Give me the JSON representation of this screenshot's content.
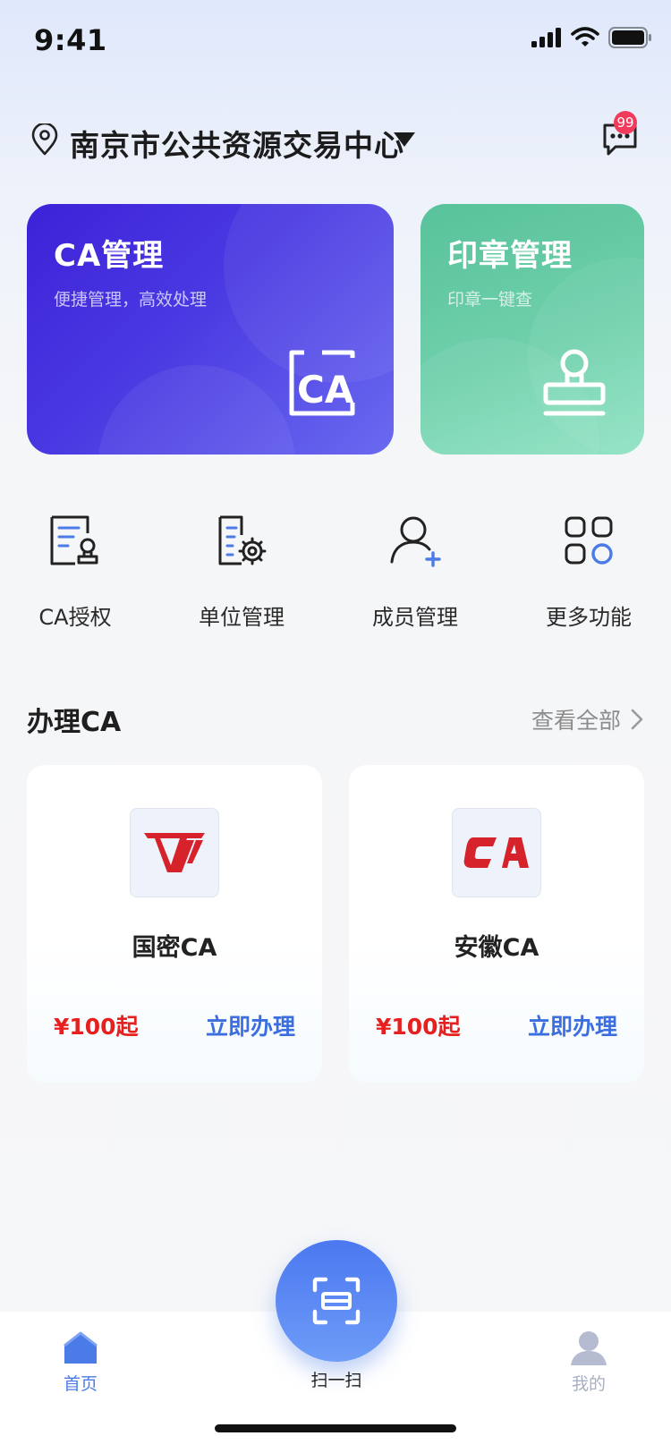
{
  "status_bar": {
    "time": "9:41"
  },
  "header": {
    "location": "南京市公共资源交易中心",
    "message_badge": "99"
  },
  "feature_cards": [
    {
      "title": "CA管理",
      "subtitle": "便捷管理，高效处理",
      "icon": "ca-certificate-icon",
      "colors": [
        "#3d22d8",
        "#6a6af0"
      ]
    },
    {
      "title": "印章管理",
      "subtitle": "印章一键查",
      "icon": "stamp-icon",
      "colors": [
        "#58c29a",
        "#90e3c4"
      ]
    }
  ],
  "quick_actions": [
    {
      "label": "CA授权",
      "icon": "ca-authorize-icon"
    },
    {
      "label": "单位管理",
      "icon": "unit-settings-icon"
    },
    {
      "label": "成员管理",
      "icon": "member-add-icon"
    },
    {
      "label": "更多功能",
      "icon": "more-grid-icon"
    }
  ],
  "section": {
    "title": "办理CA",
    "view_all": "查看全部"
  },
  "products": [
    {
      "name": "国密CA",
      "price": "¥100起",
      "action": "立即办理",
      "logo": "guomi-logo"
    },
    {
      "name": "安徽CA",
      "price": "¥100起",
      "action": "立即办理",
      "logo": "anhui-ca-logo"
    }
  ],
  "tabbar": {
    "home": "首页",
    "scan": "扫一扫",
    "me": "我的"
  },
  "colors": {
    "accent": "#4b7be6",
    "price": "#e61f1f",
    "link": "#3b6fe0"
  }
}
